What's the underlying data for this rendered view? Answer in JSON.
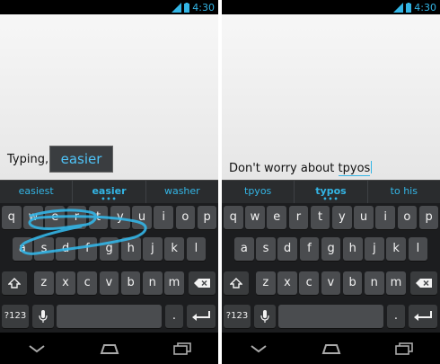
{
  "status": {
    "time": "4:30"
  },
  "left": {
    "typed_text": "Typing, jus",
    "preview_word": "easier",
    "suggestions": [
      "easiest",
      "easier",
      "washer"
    ]
  },
  "right": {
    "typed_prefix": "Don't worry about ",
    "typed_word": "tpyos",
    "suggestions": [
      "tpyos",
      "typos",
      "to his"
    ]
  },
  "keyboard": {
    "row1": [
      "q",
      "w",
      "e",
      "r",
      "t",
      "y",
      "u",
      "i",
      "o",
      "p"
    ],
    "row2": [
      "a",
      "s",
      "d",
      "f",
      "g",
      "h",
      "j",
      "k",
      "l"
    ],
    "row3": [
      "z",
      "x",
      "c",
      "v",
      "b",
      "n",
      "m"
    ],
    "symbols_label": "?123",
    "period_label": "."
  },
  "colors": {
    "accent": "#33b5e5",
    "key": "#4a4c4f",
    "keyboard_bg": "#1c1d1f"
  },
  "icons": {
    "shift": "shift-icon",
    "delete": "backspace-icon",
    "mic": "microphone-icon",
    "enter": "enter-icon",
    "back": "back-icon",
    "home": "home-icon",
    "recents": "recents-icon",
    "signal": "signal-icon",
    "battery": "battery-icon"
  }
}
